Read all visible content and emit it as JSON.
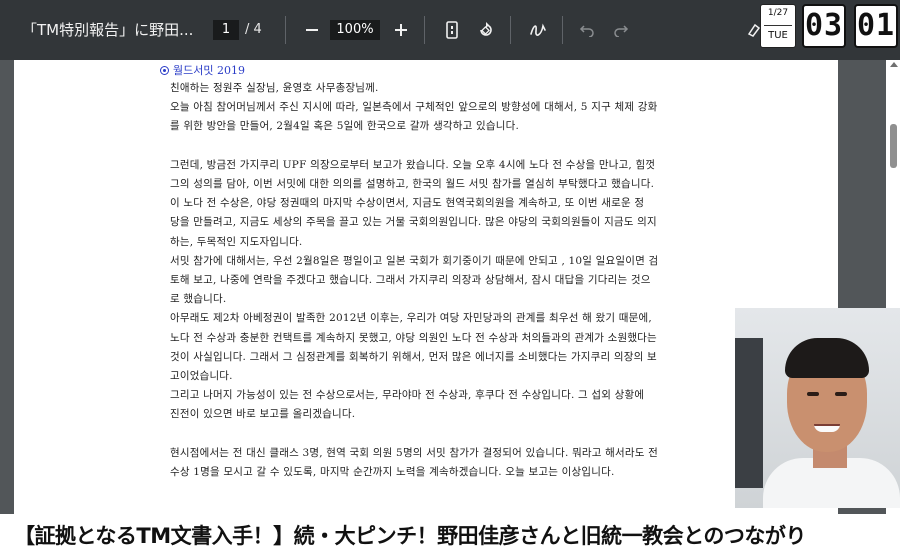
{
  "toolbar": {
    "title": "「TM特別報告」に野田...",
    "page_current": "1",
    "page_total": "/ 4",
    "zoom": "100%",
    "icons": [
      "minus-icon",
      "plus-icon",
      "fit-page-icon",
      "rotate-icon",
      "draw-icon",
      "undo-icon",
      "redo-icon"
    ]
  },
  "clock": {
    "date": "1/27",
    "weekday": "TUE",
    "hours": "03",
    "minutes": "01"
  },
  "document": {
    "heading": "월드서밋 2019",
    "lines": [
      "친애하는 정원주 실장님, 윤영호 사무총장님께.",
      "오늘 아침 참어머님께서 주신 지시에 따라, 일본측에서 구체적인 앞으로의 방향성에 대해서, 5 지구 체제 강화",
      "를 위한 방안을 만들어, 2월4일 혹은 5일에 한국으로 갈까 생각하고 있습니다.",
      "",
      "그런데, 방금전 가지쿠리 UPF 의장으로부터 보고가 왔습니다. 오늘 오후 4시에 노다 전 수상을 만나고, 힘껏",
      "그의 성의를 담아, 이번 서밋에 대한 의의를 설명하고, 한국의 월드 서밋 참가를 열심히 부탁했다고 했습니다.",
      " 이 노다 전 수상은, 야당 정권때의 마지막 수상이면서, 지금도 현역국회의원을 계속하고, 또 이번 새로운 정",
      "당을 만들려고, 지금도 세상의 주목을 끌고 있는 거물 국회의원입니다. 많은 야당의 국회의원들이 지금도 의지",
      "하는, 두목적인 지도자입니다.",
      "서밋 참가에 대해서는, 우선 2월8일은 평일이고 일본 국회가 회기중이기 때문에 안되고 , 10일 일요일이면 검",
      "토해 보고, 나중에 연락을 주겠다고 했습니다. 그래서 가지쿠리 의장과 상담해서, 잠시 대답을 기다리는 것으",
      "로 했습니다.",
      "아무래도 제2차 아베정권이 발족한 2012년 이후는, 우리가 여당 자민당과의 관계를 최우선 해 왔기 때문에,",
      "노다 전 수상과 충분한 컨택트를 계속하지 못했고, 야당 의원인 노다 전 수상과 처의들과의 관계가 소원했다는",
      "것이 사실입니다. 그래서 그 심정관계를 회복하기 위해서, 먼저 많은 에너지를 소비했다는 가지쿠리 의장의 보",
      "고이었습니다.",
      "그리고 나머지 가능성이 있는 전 수상으로서는, 무라야마 전 수상과, 후쿠다 전 수상입니다. 그 섭외 상황에",
      "진전이 있으면 바로 보고를 올리겠습니다.",
      "",
      "현시점에서는 전 대신 클래스 3명, 현역 국회 의원 5명의 서밋 참가가 결정되어 있습니다. 뭐라고 해서라도 전",
      "수상 1명을 모시고 갈 수 있도록, 마지막 순간까지 노력을 계속하겠습니다. 오늘 보고는 이상입니다."
    ]
  },
  "caption": {
    "text": "【証拠となるTM文書入手！】続・大ピンチ！野田佳彦さんと旧統一教会とのつながり"
  }
}
